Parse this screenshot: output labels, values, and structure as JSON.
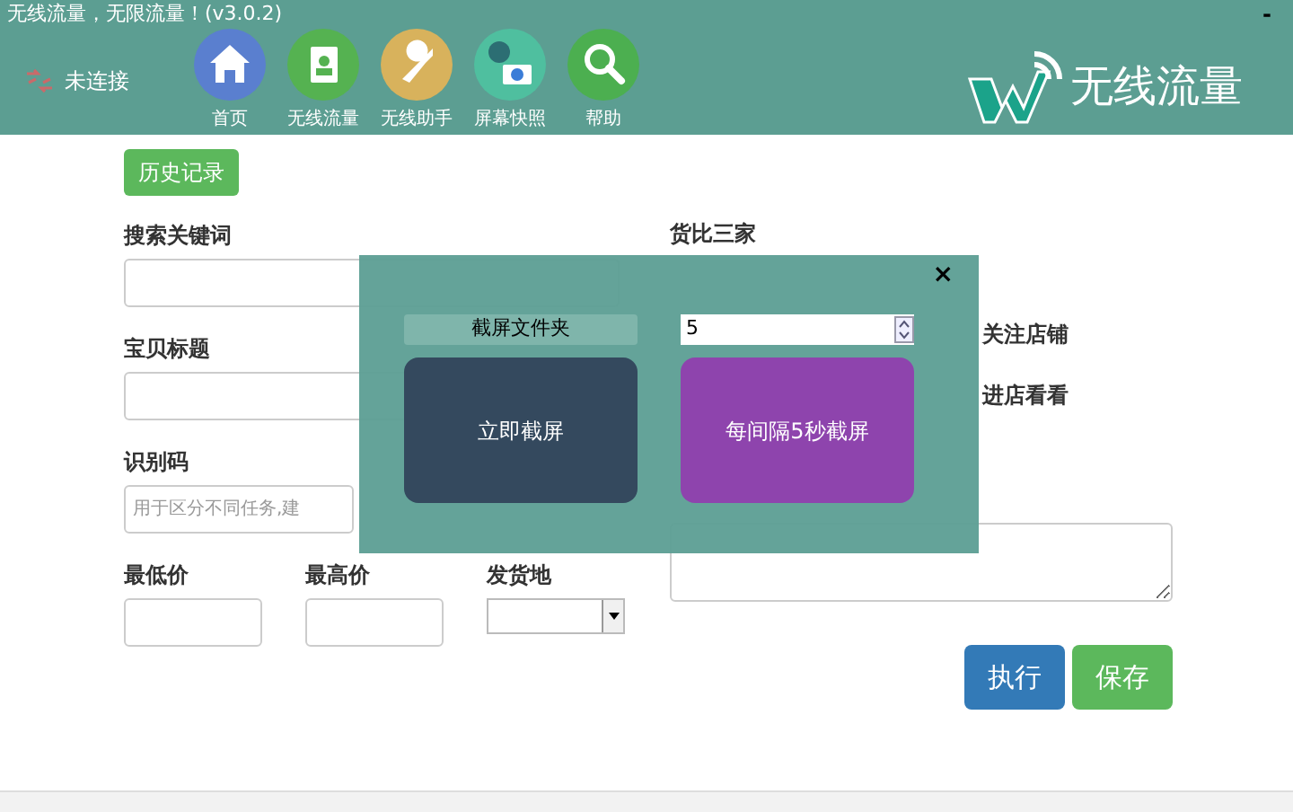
{
  "window": {
    "title": "无线流量，无限流量！(v3.0.2)",
    "minimize": "-"
  },
  "status": {
    "label": "未连接"
  },
  "nav": [
    {
      "label": "首页",
      "kind": "home"
    },
    {
      "label": "无线流量",
      "kind": "contacts"
    },
    {
      "label": "无线助手",
      "kind": "wrench"
    },
    {
      "label": "屏幕快照",
      "kind": "camera"
    },
    {
      "label": "帮助",
      "kind": "search"
    }
  ],
  "brand": {
    "name": "无线流量"
  },
  "form": {
    "history_button": "历史记录",
    "keyword": {
      "label": "搜索关键词"
    },
    "title": {
      "label": "宝贝标题"
    },
    "code": {
      "label": "识别码",
      "placeholder": "用于区分不同任务,建"
    },
    "min_price": {
      "label": "最低价"
    },
    "max_price": {
      "label": "最高价"
    },
    "origin": {
      "label": "发货地"
    },
    "compare": {
      "label": "货比三家"
    },
    "options": [
      {
        "label": "关注店铺"
      },
      {
        "label": "进店看看"
      }
    ],
    "buttons": [
      {
        "label": "执行",
        "kind": "primary"
      },
      {
        "label": "保存",
        "kind": "success"
      }
    ]
  },
  "dialog": {
    "close": "×",
    "folder_button": "截屏文件夹",
    "interval": "5",
    "capture_now": "立即截屏",
    "capture_interval": "每间隔5秒截屏"
  }
}
